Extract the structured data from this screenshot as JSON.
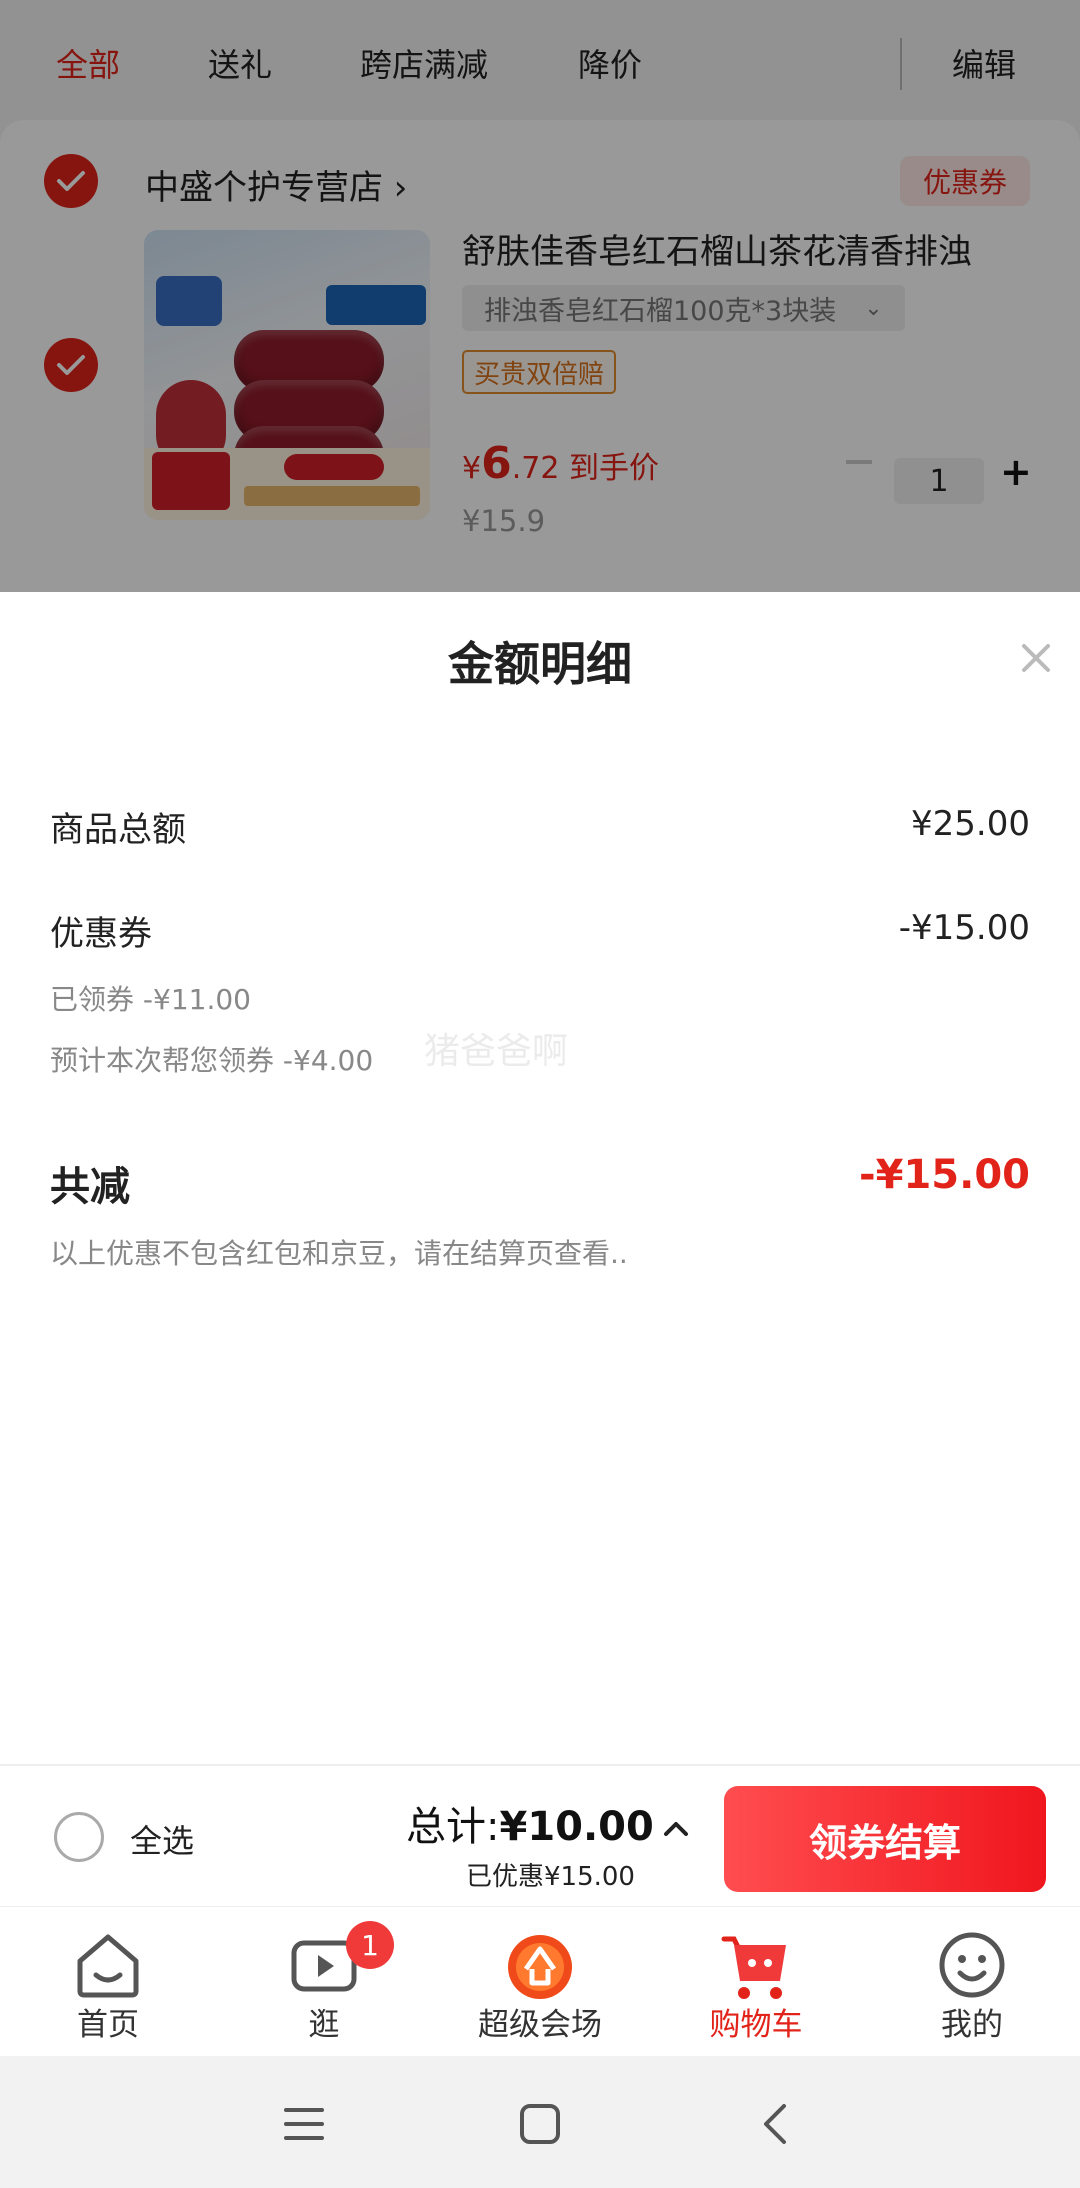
{
  "top_tabs": [
    {
      "label": "全部",
      "active": true
    },
    {
      "label": "送礼",
      "active": false
    },
    {
      "label": "跨店满减",
      "active": false
    },
    {
      "label": "降价",
      "active": false
    }
  ],
  "edit_label": "编辑",
  "shop": {
    "name": "中盛个护专营店 ›",
    "coupon_tag": "优惠券"
  },
  "product": {
    "title": "舒肤佳香皂红石榴山茶花清香排浊",
    "spec": "排浊香皂红石榴100克*3块装",
    "spec_chevron": "⌄",
    "badge": "买贵双倍赔",
    "price_symbol": "¥",
    "price_int": "6",
    "price_dec": ".72",
    "price_suffix": "到手价",
    "original_price": "¥15.9",
    "quantity": "1",
    "plus": "+"
  },
  "sheet": {
    "title": "金额明细",
    "goods_total_label": "商品总额",
    "goods_total_value": "¥25.00",
    "coupon_label": "优惠券",
    "coupon_value": "-¥15.00",
    "claimed_line": "已领券 -¥11.00",
    "estimated_line": "预计本次帮您领券 -¥4.00",
    "watermark": "猪爸爸啊",
    "total_reduce_label": "共减",
    "total_reduce_value": "-¥15.00",
    "note": "以上优惠不包含红包和京豆，请在结算页查看.."
  },
  "checkout": {
    "select_all": "全选",
    "total_prefix": "总计:",
    "total_amount": "¥10.00",
    "saved": "已优惠¥15.00",
    "button": "领券结算"
  },
  "tabbar": [
    {
      "label": "首页",
      "icon": "home-icon"
    },
    {
      "label": "逛",
      "icon": "video-icon",
      "badge": "1"
    },
    {
      "label": "超级会场",
      "icon": "super-venue-icon"
    },
    {
      "label": "购物车",
      "icon": "cart-icon",
      "active": true
    },
    {
      "label": "我的",
      "icon": "profile-icon"
    }
  ],
  "colors": {
    "accent": "#e2231a",
    "button_gradient_start": "#ff4d4f",
    "button_gradient_end": "#f0161e",
    "muted_text": "#888888"
  }
}
